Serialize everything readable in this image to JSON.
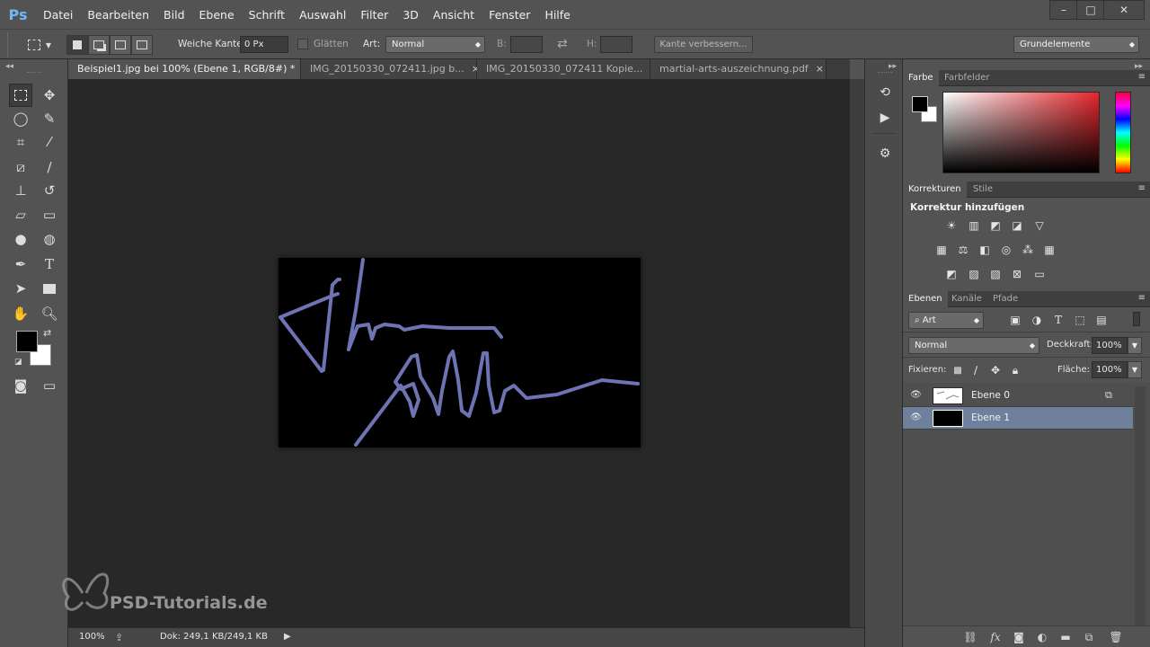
{
  "app": {
    "logo": "Ps",
    "menu": [
      "Datei",
      "Bearbeiten",
      "Bild",
      "Ebene",
      "Schrift",
      "Auswahl",
      "Filter",
      "3D",
      "Ansicht",
      "Fenster",
      "Hilfe"
    ],
    "window_controls": {
      "minimize": "–",
      "maximize": "□",
      "close": "✕"
    }
  },
  "options_bar": {
    "feather_label": "Weiche Kante:",
    "feather_value": "0 Px",
    "antialias_label": "Glätten",
    "style_label": "Art:",
    "style_value": "Normal",
    "width_label": "B:",
    "height_label": "H:",
    "refine_button": "Kante verbessern...",
    "workspace": "Grundelemente"
  },
  "tabs": [
    {
      "label": "Beispiel1.jpg bei 100% (Ebene 1, RGB/8#) *",
      "active": true
    },
    {
      "label": "IMG_20150330_072411.jpg b...",
      "active": false
    },
    {
      "label": "IMG_20150330_072411 Kopie...",
      "active": false
    },
    {
      "label": "martial-arts-auszeichnung.pdf",
      "active": false
    }
  ],
  "tab_close_glyph": "×",
  "status_bar": {
    "zoom": "100%",
    "doc_info": "Dok: 249,1 KB/249,1 KB"
  },
  "watermark": "PSD-Tutorials.de",
  "signature_color": "#6d73b3",
  "panels": {
    "color": {
      "tabs": [
        "Farbe",
        "Farbfelder"
      ],
      "foreground": "#000000",
      "background": "#ffffff"
    },
    "adjustments": {
      "tabs": [
        "Korrekturen",
        "Stile"
      ],
      "heading": "Korrektur hinzufügen"
    },
    "layers": {
      "tabs": [
        "Ebenen",
        "Kanäle",
        "Pfade"
      ],
      "filter_kind": "Art",
      "blend_mode": "Normal",
      "opacity_label": "Deckkraft:",
      "opacity_value": "100%",
      "lock_label": "Fixieren:",
      "fill_label": "Fläche:",
      "fill_value": "100%",
      "layers": [
        {
          "name": "Ebene 0",
          "selected": false,
          "visible": true
        },
        {
          "name": "Ebene 1",
          "selected": true,
          "visible": true
        }
      ]
    }
  }
}
